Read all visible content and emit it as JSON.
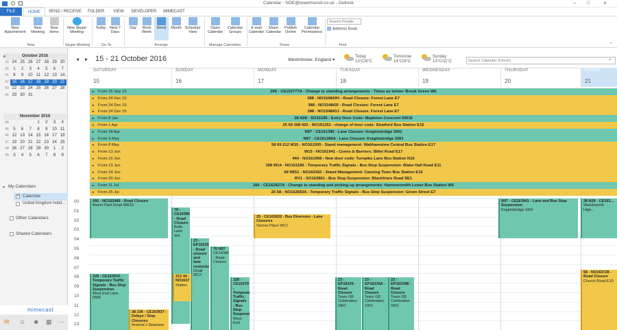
{
  "window": {
    "title": "Calendar - NOE@towertransit.co.uk - Outlook"
  },
  "tabs": [
    "FILE",
    "HOME",
    "SEND / RECEIVE",
    "FOLDER",
    "VIEW",
    "DEVELOPER",
    "MIMECAST"
  ],
  "ribbon": {
    "new_group": [
      "New Appointment",
      "New Meeting",
      "New Items"
    ],
    "new_label": "New",
    "skype": "New Skype Meeting",
    "skype_label": "Skype Meeting",
    "goto": [
      "Today",
      "Next 7 Days"
    ],
    "goto_label": "Go To",
    "arrange": [
      "Day",
      "Work Week",
      "Week",
      "Month",
      "Schedule View"
    ],
    "arrange_label": "Arrange",
    "manage": [
      "Open Calendar",
      "Calendar Groups"
    ],
    "manage_label": "Manage Calendars",
    "share": [
      "E-mail Calendar",
      "Share Calendar",
      "Publish Online",
      "Calendar Permissions"
    ],
    "share_label": "Share",
    "search_people_placeholder": "Search People",
    "address_book": "Address Book",
    "find_label": "Find"
  },
  "left": {
    "oct_title": "October 2016",
    "oct_rows": [
      [
        "40",
        "26",
        "27",
        "28",
        "29",
        "30",
        "1",
        "2"
      ],
      [
        "41",
        "3",
        "4",
        "5",
        "6",
        "7",
        "8",
        "9"
      ],
      [
        "42",
        "10",
        "11",
        "12",
        "13",
        "14",
        "15",
        "16"
      ],
      [
        "43",
        "17",
        "18",
        "19",
        "20",
        "21",
        "22",
        "23"
      ],
      [
        "44",
        "24",
        "25",
        "26",
        "27",
        "28",
        "29",
        "30"
      ],
      [
        "45",
        "31",
        "1",
        "2",
        "3",
        "4",
        "5",
        "6"
      ]
    ],
    "oct_visible": [
      [
        "42",
        "24",
        "25",
        "26",
        "27",
        "28",
        "29",
        "30"
      ],
      [
        "40",
        "1",
        "2",
        "3",
        "4",
        "5",
        "6",
        "7"
      ],
      [
        "41",
        "8",
        "9",
        "10",
        "11",
        "12",
        "13",
        "14"
      ],
      [
        "42",
        "15",
        "16",
        "17",
        "18",
        "19",
        "20",
        "21"
      ],
      [
        "43",
        "22",
        "23",
        "24",
        "25",
        "26",
        "27",
        "28"
      ],
      [
        "44",
        "29",
        "30",
        "31",
        "",
        "",
        "",
        ""
      ]
    ],
    "nov_title": "November 2016",
    "nov_rows": [
      [
        "44",
        "",
        "",
        "",
        "1",
        "2",
        "3",
        "4"
      ],
      [
        "45",
        "5",
        "6",
        "7",
        "8",
        "9",
        "10",
        "11"
      ],
      [
        "46",
        "12",
        "13",
        "14",
        "15",
        "16",
        "17",
        "18"
      ],
      [
        "47",
        "19",
        "20",
        "21",
        "22",
        "23",
        "24",
        "25"
      ],
      [
        "48",
        "26",
        "27",
        "28",
        "29",
        "30",
        "1",
        "2"
      ],
      [
        "49",
        "3",
        "4",
        "5",
        "6",
        "7",
        "8",
        "9"
      ]
    ],
    "my_calendars": "My Calendars",
    "calendar": "Calendar",
    "uk_holidays": "United Kingdom holid...",
    "other_calendars": "Other Calendars",
    "shared_calendars": "Shared Calendars",
    "mimecast": "mimecast"
  },
  "cal": {
    "range": "15 - 21 October 2016",
    "location": "Westminster, England",
    "weather": [
      {
        "day": "Today",
        "temp": "13°C/8°C"
      },
      {
        "day": "Tomorrow",
        "temp": "14°C/9°C"
      },
      {
        "day": "Sunday",
        "temp": "13°C/11°C"
      }
    ],
    "search_placeholder": "Search Calendar (Ctrl+E)",
    "days": [
      {
        "name": "SATURDAY",
        "num": "15"
      },
      {
        "name": "SUNDAY",
        "num": "16"
      },
      {
        "name": "MONDAY",
        "num": "17"
      },
      {
        "name": "TUESDAY",
        "num": "18"
      },
      {
        "name": "WEDNESDAY",
        "num": "19"
      },
      {
        "name": "THURSDAY",
        "num": "20"
      },
      {
        "name": "FRIDAY",
        "num": "21"
      }
    ],
    "banners": [
      {
        "from": "From 26 Sep 15",
        "text": "266 - CE152777A - Change to standing arrangements - Times as below: Brook Green W6",
        "color": "teal"
      },
      {
        "from": "From 24 Dec 15",
        "text": "388 - NO154843H - Road Closure: Forest Lane E7",
        "color": "gold"
      },
      {
        "from": "From 24 Dec 15",
        "text": "388 - NO154843I - Road Closure: Forest Lane E7",
        "color": "gold"
      },
      {
        "from": "From 24 Dec 15",
        "text": "388 - NO154843J - Road Closure: Forest Lane E7",
        "color": "gold"
      },
      {
        "from": "From 8 Jan",
        "text": "28 N28 - SO16196 - Entry Door Code: Mapleton Crescent SW18",
        "color": "teal"
      },
      {
        "from": "From 1 Apr",
        "text": "25 69 308 425 - NO161252 - change of door code: Stratford Bus Station E15",
        "color": "gold"
      },
      {
        "from": "From 28 Apr",
        "text": "N97 - CE161386 - Lane Closure: Knightsbridge SW1",
        "color": "teal"
      },
      {
        "from": "From 3 May",
        "text": "N97 - CE161386A - Lane Closure: Knightsbridge SW1",
        "color": "teal"
      },
      {
        "from": "From 8 May",
        "text": "58 69 212 W15 - NO161595 - Stand management: Walthamstow Central Bus Station E17",
        "color": "gold"
      },
      {
        "from": "From 13 Jun",
        "text": "W15 - NO161941 - Cones & Barriers: Billet Road E17",
        "color": "gold"
      },
      {
        "from": "From 16 Jun",
        "text": "444 - NO161958 - New door code: Turnpike Lane Bus Station N15",
        "color": "gold"
      },
      {
        "from": "From 13 Jun",
        "text": "308 W14 - NO161186 - Temporary Traffic Signals - Bus Stop Suspension: Blake Hall Road E11",
        "color": "gold"
      },
      {
        "from": "From 24 Jun",
        "text": "69 N551 - NO162262 - Stand Management: Canning Town Bus Station E16",
        "color": "gold"
      },
      {
        "from": "From 29 Jun",
        "text": "RV1 - SO163861 - Bus Stop Suspension: Blackfriars Road SE1",
        "color": "gold"
      },
      {
        "from": "From 11 Jul",
        "text": "266 - CE162627A - Change to standing and picking up arrangements: Hammersmith Lower Bus Station W6",
        "color": "teal"
      },
      {
        "from": "From 25 Jul",
        "text": "25 58 - NO162683A - Temporary Traffic Signals - Bus Stop Suspension: Green Street E7",
        "color": "gold"
      }
    ],
    "hours": [
      "00",
      "01",
      "02",
      "03",
      "04",
      "05",
      "06",
      "07",
      "08",
      "09",
      "10",
      "11",
      "12",
      "13"
    ],
    "appts": [
      {
        "text": "266 - NO162486 - Road Closure\nManor Park Road NW10",
        "color": "teal"
      },
      {
        "text": "70 - CE16380 - Road Closure\nBollo Lane W4",
        "color": "teal"
      },
      {
        "text": "23 - EP16235 - Road closure and lane restrictions\nDivall WC2",
        "color": "teal"
      },
      {
        "text": "70 N97\nCE16384 - Road Closure\nExhibition Road SW7",
        "color": "teal"
      },
      {
        "text": "328 - CE16379 - Temporary Traffic Signals - Bus Stop Suspension\nWest End",
        "color": "teal"
      },
      {
        "text": "25 - CE163832 - Bus Diversion - Lane Closures\nVernon Place WC1",
        "color": "gold"
      },
      {
        "text": "N97 - CE163941 - Lane and Bus Stop Suspension\nKnightsbridge SW1",
        "color": "teal"
      },
      {
        "text": "28 N28 - CE163...\nWandsworth High...",
        "color": "teal"
      },
      {
        "text": "328 - CE163933 - Temporary Traffic Signals - Bus Stop Suspension\nWest End Lane NW6",
        "color": "teal"
      },
      {
        "text": "212 44 - NO1637\nStation",
        "color": "gold"
      },
      {
        "text": "23 - EP16239 - Road Closure\nTeam GB Celebration SW1",
        "color": "teal"
      },
      {
        "text": "23 - EP16239A - Road Closure\nTeam GB Celebration SW1",
        "color": "teal"
      },
      {
        "text": "23 - EP16239B - Road Closure\nTeam GB Celebration SW1",
        "color": "teal"
      },
      {
        "text": "58 - NO163728 - Road Closure\nChurch Road E10",
        "color": "gold"
      },
      {
        "text": "38 236 - CE163937 - Delays / Stop Closures\nArsenal v Swansea",
        "color": "gold"
      }
    ]
  },
  "colors": {
    "accent": "#2a71c8",
    "teal": "#6fc7ad",
    "gold": "#f2c84b",
    "friday": "#cfe3f7"
  }
}
